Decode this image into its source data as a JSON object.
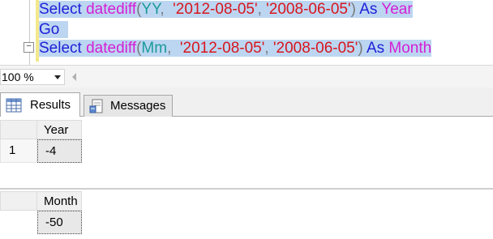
{
  "editor": {
    "lines": [
      {
        "tokens": [
          {
            "text": "Select",
            "kind": "kw"
          },
          {
            "text": " ",
            "kind": "pun"
          },
          {
            "text": "datediff",
            "kind": "fn"
          },
          {
            "text": "(",
            "kind": "pun"
          },
          {
            "text": "YY",
            "kind": "arg"
          },
          {
            "text": ",  ",
            "kind": "pun"
          },
          {
            "text": "'2012-08-05'",
            "kind": "str"
          },
          {
            "text": ", ",
            "kind": "pun"
          },
          {
            "text": "'2008-06-05'",
            "kind": "str"
          },
          {
            "text": ") ",
            "kind": "pun"
          },
          {
            "text": "As",
            "kind": "kw"
          },
          {
            "text": " ",
            "kind": "pun"
          },
          {
            "text": "Year",
            "kind": "fn"
          }
        ]
      },
      {
        "tokens": [
          {
            "text": "Go",
            "kind": "kw"
          },
          {
            "text": "  ",
            "kind": "pun"
          }
        ]
      },
      {
        "tokens": [
          {
            "text": "Select",
            "kind": "kw"
          },
          {
            "text": " ",
            "kind": "pun"
          },
          {
            "text": "datediff",
            "kind": "fn"
          },
          {
            "text": "(",
            "kind": "pun"
          },
          {
            "text": "Mm",
            "kind": "arg"
          },
          {
            "text": ",  ",
            "kind": "pun"
          },
          {
            "text": "'2012-08-05'",
            "kind": "str"
          },
          {
            "text": ", ",
            "kind": "pun"
          },
          {
            "text": "'2008-06-05'",
            "kind": "str"
          },
          {
            "text": ") ",
            "kind": "pun"
          },
          {
            "text": "As",
            "kind": "kw"
          },
          {
            "text": " ",
            "kind": "pun"
          },
          {
            "text": "Month",
            "kind": "fn"
          }
        ]
      }
    ],
    "fold_glyph": "−"
  },
  "zoom": {
    "value": "100 %"
  },
  "tabs": {
    "results_label": "Results",
    "messages_label": "Messages"
  },
  "results": [
    {
      "column": "Year",
      "row_number": "1",
      "value": "-4"
    },
    {
      "column": "Month",
      "row_number": "",
      "value": "-50"
    }
  ],
  "colors": {
    "keyword": "#2020d8",
    "function": "#d41ed4",
    "argument": "#1b9b9b",
    "string": "#d8161c",
    "selection": "#bcd6f2"
  }
}
